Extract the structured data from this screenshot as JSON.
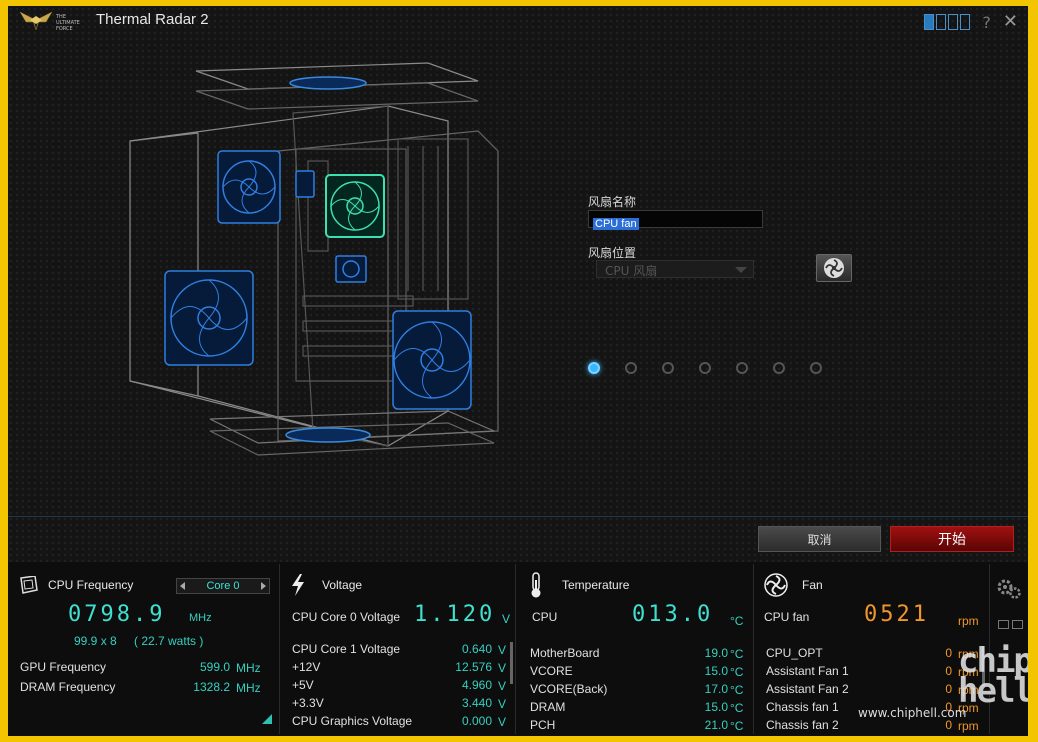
{
  "titlebar": {
    "app_title": "Thermal Radar 2",
    "logo_text": "THE ULTIMATE FORCE",
    "help": "?",
    "close": "✕"
  },
  "config": {
    "fan_name_label": "风扇名称",
    "fan_name_value": "CPU fan",
    "fan_position_label": "风扇位置",
    "fan_position_value": "CPU 风扇",
    "pager_dots": 7,
    "pager_active": 0
  },
  "buttons": {
    "cancel": "取消",
    "start": "开始"
  },
  "cpu_freq": {
    "title": "CPU Frequency",
    "core_select": "Core 0",
    "value": "0798.9",
    "unit": "MHz",
    "detail": "99.9 x 8",
    "watts": "( 22.7 watts )",
    "rows": [
      {
        "label": "GPU Frequency",
        "value": "599.0",
        "unit": "MHz"
      },
      {
        "label": "DRAM Frequency",
        "value": "1328.2",
        "unit": "MHz"
      }
    ]
  },
  "voltage": {
    "title": "Voltage",
    "main_label": "CPU Core 0 Voltage",
    "main_value": "1.120",
    "main_unit": "V",
    "rows": [
      {
        "label": "CPU Core 1 Voltage",
        "value": "0.640",
        "unit": "V"
      },
      {
        "label": "+12V",
        "value": "12.576",
        "unit": "V"
      },
      {
        "label": "+5V",
        "value": "4.960",
        "unit": "V"
      },
      {
        "label": "+3.3V",
        "value": "3.440",
        "unit": "V"
      },
      {
        "label": "CPU Graphics Voltage",
        "value": "0.000",
        "unit": "V"
      }
    ]
  },
  "temperature": {
    "title": "Temperature",
    "main_label": "CPU",
    "main_value": "013.0",
    "main_unit": "°C",
    "rows": [
      {
        "label": "MotherBoard",
        "value": "19.0",
        "unit": "°C"
      },
      {
        "label": "VCORE",
        "value": "15.0",
        "unit": "°C"
      },
      {
        "label": "VCORE(Back)",
        "value": "17.0",
        "unit": "°C"
      },
      {
        "label": "DRAM",
        "value": "15.0",
        "unit": "°C"
      },
      {
        "label": "PCH",
        "value": "21.0",
        "unit": "°C"
      }
    ]
  },
  "fan": {
    "title": "Fan",
    "main_label": "CPU fan",
    "main_value": "0521",
    "main_unit": "rpm",
    "rows": [
      {
        "label": "CPU_OPT",
        "value": "0",
        "unit": "rpm"
      },
      {
        "label": "Assistant Fan 1",
        "value": "0",
        "unit": "rpm"
      },
      {
        "label": "Assistant Fan 2",
        "value": "0",
        "unit": "rpm"
      },
      {
        "label": "Chassis fan 1",
        "value": "0",
        "unit": "rpm"
      },
      {
        "label": "Chassis fan 2",
        "value": "0",
        "unit": "rpm"
      }
    ]
  },
  "watermark": {
    "site": "www.chiphell.com",
    "logo": "chip hell"
  },
  "colors": {
    "accent_cyan": "#3ee0d0",
    "accent_blue": "#3ab6ff",
    "fan_orange": "#f0962a",
    "start_red": "#a01010",
    "frame_yellow": "#f3c400"
  }
}
